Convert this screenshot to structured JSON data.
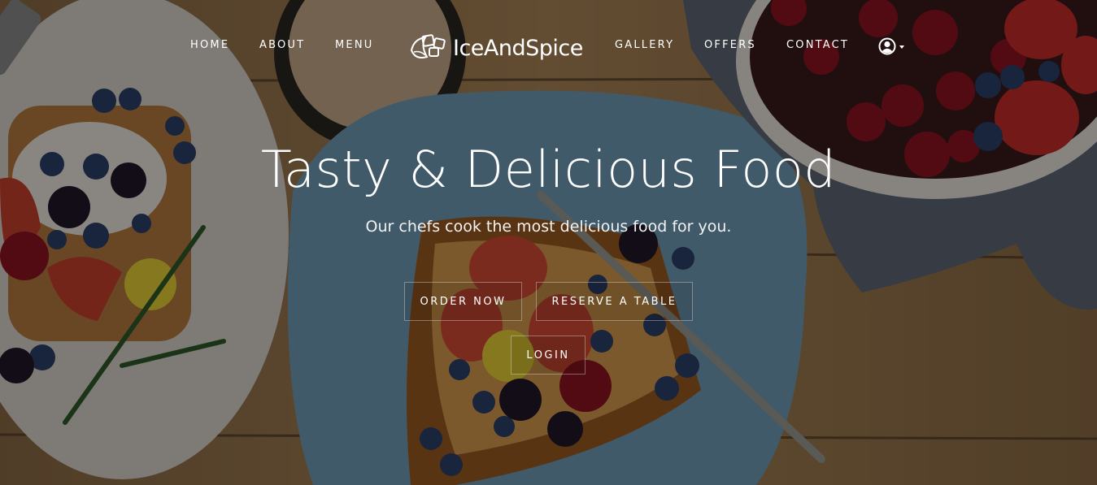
{
  "nav": {
    "home": "HOME",
    "about": "ABOUT",
    "menu": "MENU",
    "gallery": "GALLERY",
    "offers": "OFFERS",
    "contact": "CONTACT"
  },
  "logo": {
    "text": "IceAndSpice",
    "icon": "ice-cubes-leaf-icon"
  },
  "user_menu": {
    "icon": "user-circle-icon",
    "caret_icon": "caret-down-icon"
  },
  "hero": {
    "title": "Tasty & Delicious Food",
    "subtitle": "Our chefs cook the most delicious food for you.",
    "buttons": {
      "order": "ORDER NOW",
      "reserve": "RESERVE A TABLE",
      "login": "LOGIN"
    }
  },
  "colors": {
    "overlay": "#000000",
    "text": "#ffffff",
    "plate": "#6f9cb5",
    "wood": "#9c7a52"
  }
}
